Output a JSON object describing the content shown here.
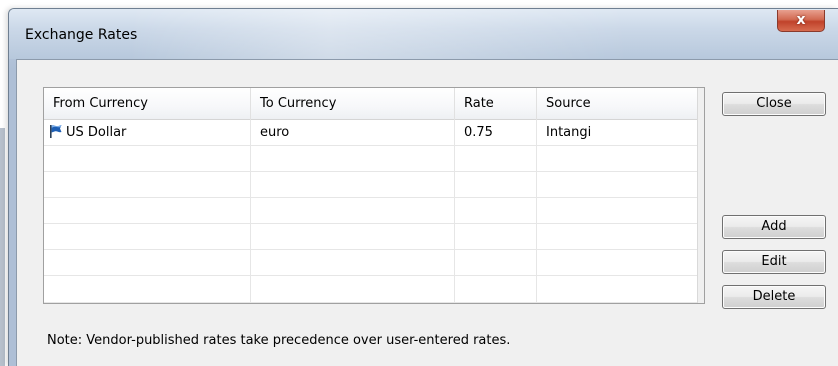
{
  "window": {
    "title": "Exchange Rates",
    "close_glyph": "x"
  },
  "grid": {
    "columns": [
      "From Currency",
      "To Currency",
      "Rate",
      "Source"
    ],
    "rows": [
      {
        "from": "US Dollar",
        "to": "euro",
        "rate": "0.75",
        "source": "Intangi",
        "icon": "flag-icon"
      }
    ]
  },
  "buttons": {
    "close": "Close",
    "add": "Add",
    "edit": "Edit",
    "delete": "Delete"
  },
  "note": "Note: Vendor-published rates take precedence over user-entered rates.",
  "colors": {
    "flag": "#1e5fb4"
  }
}
